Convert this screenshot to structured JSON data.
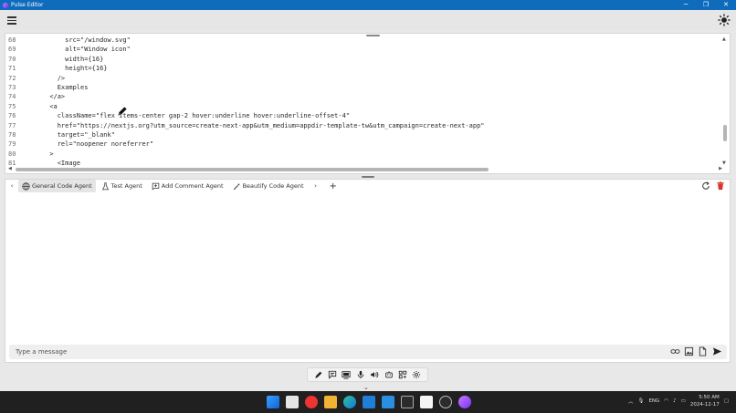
{
  "window": {
    "title": "Pulse Editor",
    "minimize": "─",
    "maximize": "❐",
    "close": "✕"
  },
  "editor": {
    "lines": [
      {
        "num": "68",
        "text": "          src=\"/window.svg\""
      },
      {
        "num": "69",
        "text": "          alt=\"Window icon\""
      },
      {
        "num": "70",
        "text": "          width={16}"
      },
      {
        "num": "71",
        "text": "          height={16}"
      },
      {
        "num": "72",
        "text": "        />"
      },
      {
        "num": "73",
        "text": "        Examples"
      },
      {
        "num": "74",
        "text": "      </a>"
      },
      {
        "num": "75",
        "text": "      <a"
      },
      {
        "num": "76",
        "text": "        className=\"flex items-center gap-2 hover:underline hover:underline-offset-4\""
      },
      {
        "num": "77",
        "text": "        href=\"https://nextjs.org?utm_source=create-next-app&utm_medium=appdir-template-tw&utm_campaign=create-next-app\""
      },
      {
        "num": "78",
        "text": "        target=\"_blank\""
      },
      {
        "num": "79",
        "text": "        rel=\"noopener noreferrer\""
      },
      {
        "num": "80",
        "text": "      >"
      },
      {
        "num": "81",
        "text": "        <Image"
      }
    ]
  },
  "agent_tabs": [
    {
      "label": "General Code Agent",
      "icon": "globe-icon",
      "active": true
    },
    {
      "label": "Test Agent",
      "icon": "flask-icon",
      "active": false
    },
    {
      "label": "Add Comment Agent",
      "icon": "comment-add-icon",
      "active": false
    },
    {
      "label": "Beautify Code Agent",
      "icon": "magic-wand-icon",
      "active": false
    }
  ],
  "tab_add": "+",
  "tab_prev": "‹",
  "tab_next": "›",
  "message": {
    "placeholder": "Type a message"
  },
  "taskbar": {
    "lang": "ENG",
    "time": "5:50 AM",
    "date": "2024-12-17"
  },
  "colors": {
    "titlebar": "#0f6cbd",
    "delete": "#d9342b",
    "taskbar": "#202020"
  }
}
